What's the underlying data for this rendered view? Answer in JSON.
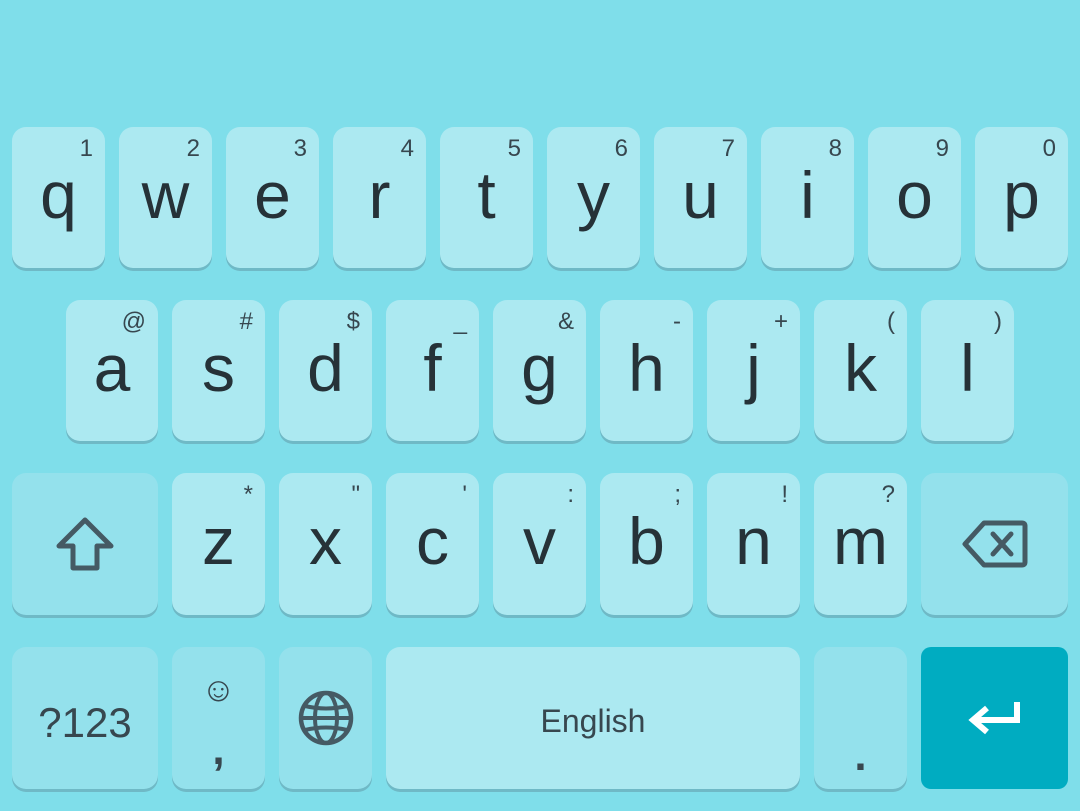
{
  "keyboard": {
    "row1": [
      {
        "main": "q",
        "hint": "1"
      },
      {
        "main": "w",
        "hint": "2"
      },
      {
        "main": "e",
        "hint": "3"
      },
      {
        "main": "r",
        "hint": "4"
      },
      {
        "main": "t",
        "hint": "5"
      },
      {
        "main": "y",
        "hint": "6"
      },
      {
        "main": "u",
        "hint": "7"
      },
      {
        "main": "i",
        "hint": "8"
      },
      {
        "main": "o",
        "hint": "9"
      },
      {
        "main": "p",
        "hint": "0"
      }
    ],
    "row2": [
      {
        "main": "a",
        "hint": "@"
      },
      {
        "main": "s",
        "hint": "#"
      },
      {
        "main": "d",
        "hint": "$"
      },
      {
        "main": "f",
        "hint": "_"
      },
      {
        "main": "g",
        "hint": "&"
      },
      {
        "main": "h",
        "hint": "-"
      },
      {
        "main": "j",
        "hint": "+"
      },
      {
        "main": "k",
        "hint": "("
      },
      {
        "main": "l",
        "hint": ")"
      }
    ],
    "row3": [
      {
        "main": "z",
        "hint": "*"
      },
      {
        "main": "x",
        "hint": "\""
      },
      {
        "main": "c",
        "hint": "'"
      },
      {
        "main": "v",
        "hint": ":"
      },
      {
        "main": "b",
        "hint": ";"
      },
      {
        "main": "n",
        "hint": "!"
      },
      {
        "main": "m",
        "hint": "?"
      }
    ],
    "symbols_label": "?123",
    "comma_label": ",",
    "emoji_glyph": "☺",
    "space_label": "English",
    "period_label": ".",
    "icons": {
      "shift": "shift-icon",
      "backspace": "backspace-icon",
      "globe": "globe-icon",
      "emoji": "emoji-icon",
      "enter": "enter-icon"
    },
    "colors": {
      "background": "#7fdeea",
      "key": "#ace9f1",
      "function_key": "#94e1ec",
      "enter_key": "#00acc1",
      "text": "#263238"
    }
  }
}
